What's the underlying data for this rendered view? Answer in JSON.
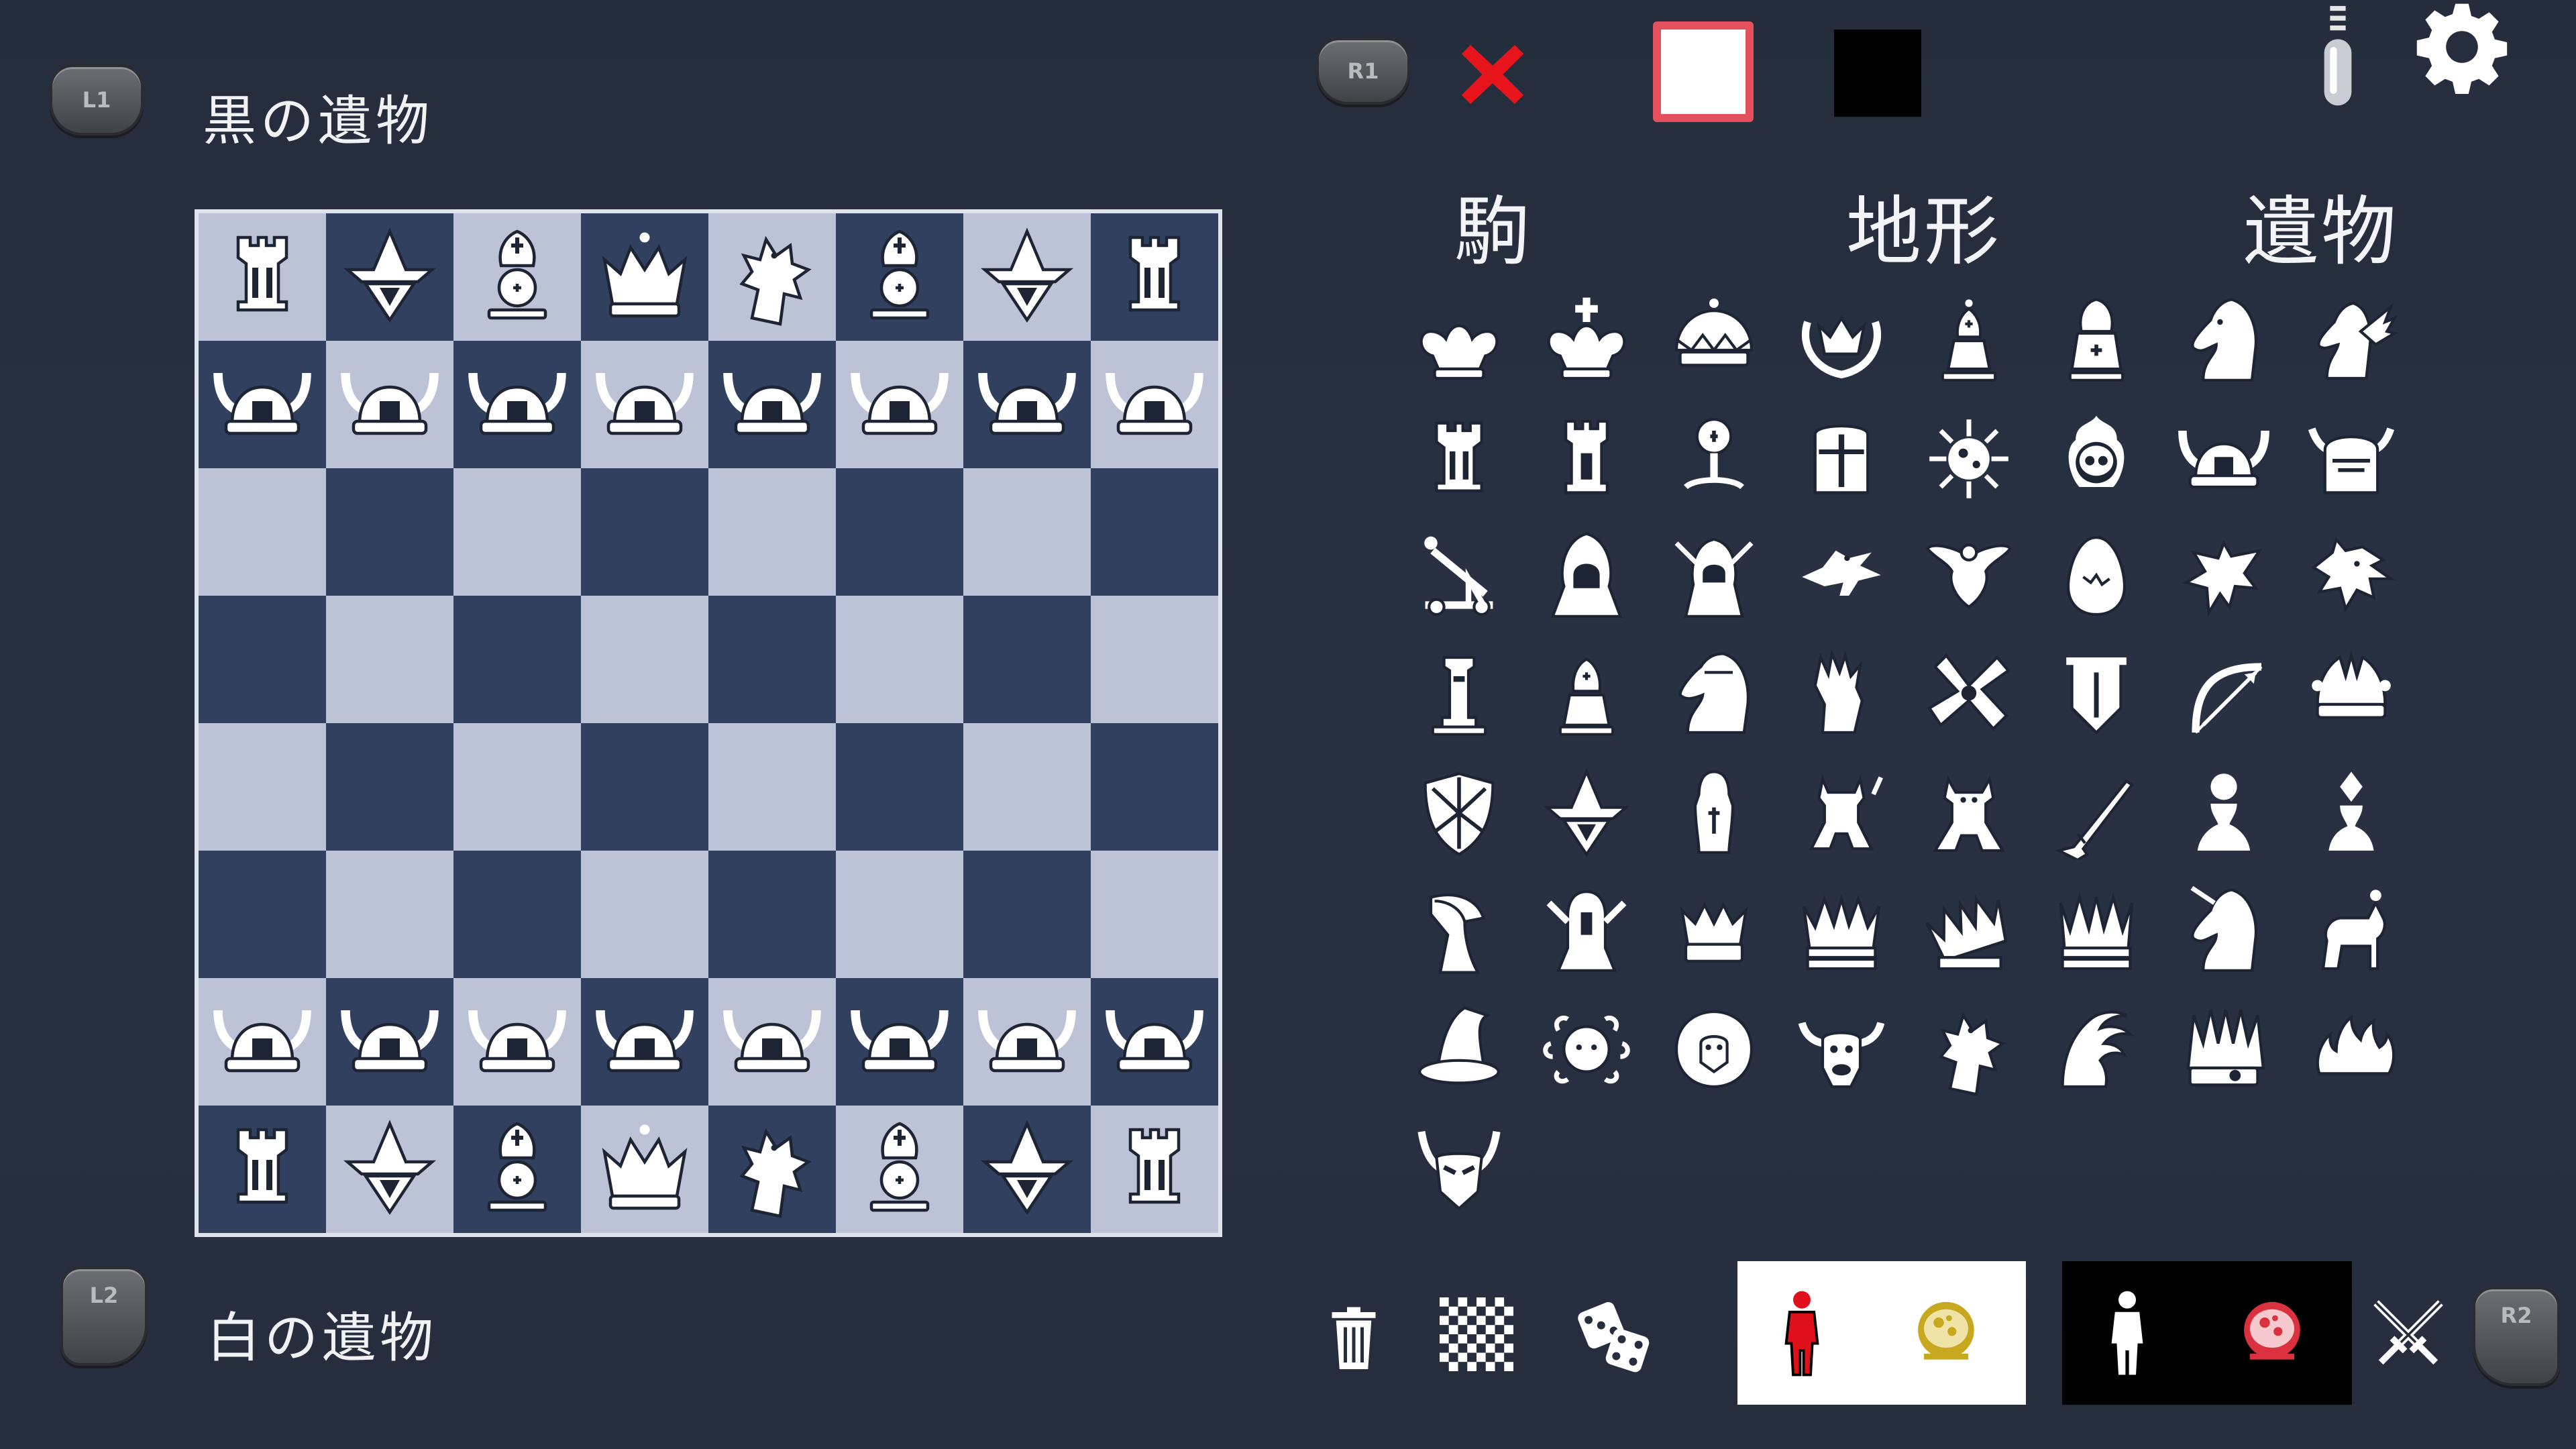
{
  "header": {
    "black_relics_label": "黒の遺物",
    "white_relics_label": "白の遺物",
    "buttons": {
      "l1": "L1",
      "l2": "L2",
      "r1": "R1",
      "r2": "R2"
    }
  },
  "toolbar": {
    "color_swatches": [
      {
        "name": "white",
        "hex": "#ffffff",
        "selected": true
      },
      {
        "name": "black",
        "hex": "#000000",
        "selected": false
      }
    ],
    "accent_color": "#e4505c",
    "delete_color": "#e8141c"
  },
  "editor_tabs": {
    "pieces": "駒",
    "terrain": "地形",
    "relics": "遺物"
  },
  "board": {
    "rows": [
      [
        "rook",
        "wizard",
        "bishop",
        "queen",
        "griffin",
        "bishop",
        "wizard",
        "rook"
      ],
      [
        "viking",
        "viking",
        "viking",
        "viking",
        "viking",
        "viking",
        "viking",
        "viking"
      ],
      [
        "",
        "",
        "",
        "",
        "",
        "",
        "",
        ""
      ],
      [
        "",
        "",
        "",
        "",
        "",
        "",
        "",
        ""
      ],
      [
        "",
        "",
        "",
        "",
        "",
        "",
        "",
        ""
      ],
      [
        "",
        "",
        "",
        "",
        "",
        "",
        "",
        ""
      ],
      [
        "viking",
        "viking",
        "viking",
        "viking",
        "viking",
        "viking",
        "viking",
        "viking"
      ],
      [
        "rook",
        "wizard",
        "bishop",
        "queen",
        "griffin",
        "bishop",
        "wizard",
        "rook"
      ]
    ],
    "light_color": "#bcc3d6",
    "dark_color": "#31405e"
  },
  "palette": [
    "king",
    "king-cross",
    "queen-crown",
    "laurel-crown",
    "bishop-small",
    "cardinal",
    "knight",
    "pegasus",
    "rook",
    "tower",
    "cleric",
    "templar-helm",
    "virus",
    "skull",
    "viking",
    "dwarf",
    "catapult",
    "hooded",
    "assassin",
    "raven",
    "phoenix",
    "egg",
    "wyvern",
    "dragon",
    "lighthouse",
    "bishop-plain",
    "knight-armored",
    "fist",
    "chaos",
    "banner",
    "bow",
    "jester",
    "shield",
    "wizard",
    "monk",
    "demon",
    "imp",
    "musket",
    "pawn",
    "pawn-diamond",
    "reaper",
    "valkyrie",
    "crown-small",
    "crown-large",
    "crown-fallen",
    "crown-tall",
    "unicorn",
    "centaur",
    "witch-hat",
    "medusa",
    "lion",
    "minotaur",
    "griffin",
    "hydra",
    "spiked-crown",
    "flame-crown",
    "horned-mask"
  ],
  "bottom": {
    "tools": [
      "trash-icon",
      "checkerboard-icon",
      "dice-icon"
    ],
    "white_panel_colors": {
      "figure": "#e0101a",
      "relic": "#c8a81e"
    },
    "black_panel_colors": {
      "figure": "#ffffff",
      "relic": "#d9323e"
    }
  }
}
